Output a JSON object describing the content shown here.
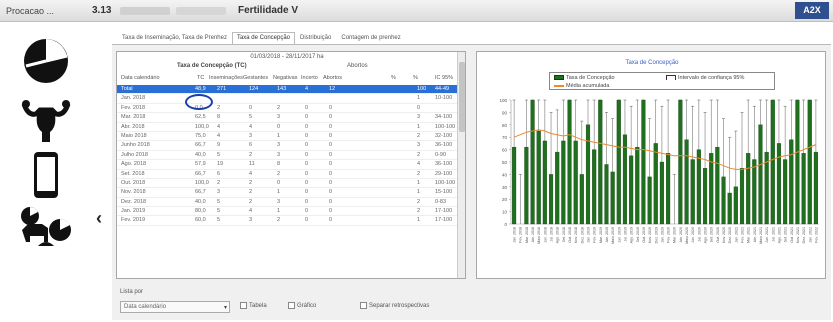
{
  "window": {
    "app_label": "Procacao ...",
    "version": "3.13",
    "title": "Fertilidade V",
    "corner_label": "A2X"
  },
  "left_icons": [
    "pie-chart-icon",
    "uterus-icon",
    "smartphone-icon",
    "cattle-group-icon"
  ],
  "tabs": [
    {
      "label": "Taxa de Inseminação, Taxa de Prenhez",
      "active": false
    },
    {
      "label": "Taxa de Concepção",
      "active": true
    },
    {
      "label": "Distribuição",
      "active": false
    },
    {
      "label": "Contagem de prenhez",
      "active": false
    }
  ],
  "table": {
    "period": "01/03/2018 - 28/11/2017 ha",
    "subtitle": "Taxa de Concepção (TC)",
    "subtitle_right": "Abortos",
    "columns": [
      "Data calendário",
      "TC",
      "Inseminações",
      "Gestantes",
      "Negativas",
      "Incerto",
      "Abortos",
      "%",
      "%",
      "IC 95%"
    ],
    "rows": [
      {
        "date": "Total",
        "tc": "48,9",
        "ins": "271",
        "ges": "124",
        "neg": "143",
        "inc": "4",
        "abo": "12",
        "p1": "",
        "p2": "100",
        "ic": "44-49"
      },
      {
        "date": "Jan. 2018",
        "tc": "",
        "ins": "",
        "ges": "",
        "neg": "",
        "inc": "",
        "abo": "",
        "p1": "",
        "p2": "1",
        "ic": "10-100"
      },
      {
        "date": "Fev. 2018",
        "tc": "0,0",
        "ins": "2",
        "ges": "0",
        "neg": "2",
        "inc": "0",
        "abo": "0",
        "p1": "",
        "p2": "0",
        "ic": ""
      },
      {
        "date": "Mar. 2018",
        "tc": "62,5",
        "ins": "8",
        "ges": "5",
        "neg": "3",
        "inc": "0",
        "abo": "0",
        "p1": "",
        "p2": "3",
        "ic": "34-100"
      },
      {
        "date": "Abr. 2018",
        "tc": "100,0",
        "ins": "4",
        "ges": "4",
        "neg": "0",
        "inc": "0",
        "abo": "0",
        "p1": "",
        "p2": "1",
        "ic": "100-100"
      },
      {
        "date": "Maio 2018",
        "tc": "75,0",
        "ins": "4",
        "ges": "3",
        "neg": "1",
        "inc": "0",
        "abo": "0",
        "p1": "",
        "p2": "2",
        "ic": "32-100"
      },
      {
        "date": "Junho 2018",
        "tc": "66,7",
        "ins": "9",
        "ges": "6",
        "neg": "3",
        "inc": "0",
        "abo": "0",
        "p1": "",
        "p2": "3",
        "ic": "36-100"
      },
      {
        "date": "Julho 2018",
        "tc": "40,0",
        "ins": "5",
        "ges": "2",
        "neg": "3",
        "inc": "0",
        "abo": "0",
        "p1": "",
        "p2": "2",
        "ic": "0-90"
      },
      {
        "date": "Ago. 2018",
        "tc": "57,9",
        "ins": "19",
        "ges": "11",
        "neg": "8",
        "inc": "0",
        "abo": "0",
        "p1": "",
        "p2": "4",
        "ic": "36-100"
      },
      {
        "date": "Set. 2018",
        "tc": "66,7",
        "ins": "6",
        "ges": "4",
        "neg": "2",
        "inc": "0",
        "abo": "0",
        "p1": "",
        "p2": "2",
        "ic": "29-100"
      },
      {
        "date": "Out. 2018",
        "tc": "100,0",
        "ins": "2",
        "ges": "2",
        "neg": "0",
        "inc": "0",
        "abo": "0",
        "p1": "",
        "p2": "1",
        "ic": "100-100"
      },
      {
        "date": "Nov. 2018",
        "tc": "66,7",
        "ins": "3",
        "ges": "2",
        "neg": "1",
        "inc": "0",
        "abo": "0",
        "p1": "",
        "p2": "1",
        "ic": "15-100"
      },
      {
        "date": "Dez. 2018",
        "tc": "40,0",
        "ins": "5",
        "ges": "2",
        "neg": "3",
        "inc": "0",
        "abo": "0",
        "p1": "",
        "p2": "2",
        "ic": "0-83"
      },
      {
        "date": "Jan. 2019",
        "tc": "80,0",
        "ins": "5",
        "ges": "4",
        "neg": "1",
        "inc": "0",
        "abo": "0",
        "p1": "",
        "p2": "2",
        "ic": "17-100"
      },
      {
        "date": "Fev. 2019",
        "tc": "60,0",
        "ins": "5",
        "ges": "3",
        "neg": "2",
        "inc": "0",
        "abo": "0",
        "p1": "",
        "p2": "1",
        "ic": "17-100"
      }
    ]
  },
  "bottom": {
    "list_label": "Lista por",
    "select_value": "Data calendário",
    "checkboxes": [
      "Tabela",
      "Gráfico",
      "Separar retrospectivas"
    ]
  },
  "chart": {
    "title": "Taxa de Concepção",
    "legend": [
      "Taxa de Concepção",
      "Intervalo de confiança 95%",
      "Média acumulada"
    ],
    "colors": {
      "bar": "#1f6f1f",
      "bar_dark": "#0e3f0e",
      "line": "#e88a2e",
      "error": "#333333"
    }
  },
  "chart_data": {
    "type": "bar",
    "title": "Taxa de Concepção",
    "ylim": [
      0,
      100
    ],
    "yticks": [
      0,
      10,
      20,
      30,
      40,
      50,
      60,
      70,
      80,
      90,
      100
    ],
    "categories": [
      "Jan. 2018",
      "Fev. 2018",
      "Mar. 2018",
      "Abr. 2018",
      "Maio 2018",
      "Jun. 2018",
      "Jul. 2018",
      "Ago. 2018",
      "Set. 2018",
      "Out. 2018",
      "Nov. 2018",
      "Dez. 2018",
      "Jan. 2019",
      "Fev. 2019",
      "Mar. 2019",
      "Abr. 2019",
      "Maio 2019",
      "Jun. 2019",
      "Jul. 2019",
      "Ago. 2019",
      "Set. 2019",
      "Out. 2019",
      "Nov. 2019",
      "Dez. 2019",
      "Jan. 2020",
      "Fev. 2020",
      "Mar. 2020",
      "Abr. 2020",
      "Maio 2020",
      "Jun. 2020",
      "Jul. 2020",
      "Ago. 2020",
      "Set. 2020",
      "Out. 2020",
      "Nov. 2020",
      "Dez. 2020",
      "Jan. 2021",
      "Fev. 2021",
      "Mar. 2021",
      "Abr. 2021",
      "Maio 2021",
      "Jun. 2021",
      "Jul. 2021",
      "Ago. 2021",
      "Set. 2021",
      "Out. 2021",
      "Nov. 2021",
      "Dez. 2021",
      "Jan. 2022",
      "Fev. 2022"
    ],
    "series": [
      {
        "name": "Taxa de Concepção",
        "values": [
          62,
          0,
          62,
          100,
          75,
          67,
          40,
          58,
          67,
          100,
          67,
          40,
          80,
          60,
          100,
          48,
          42,
          100,
          72,
          55,
          62,
          100,
          38,
          65,
          50,
          57,
          0,
          100,
          68,
          52,
          60,
          45,
          57,
          62,
          38,
          25,
          30,
          45,
          57,
          52,
          80,
          58,
          100,
          65,
          52,
          68,
          100,
          57,
          100,
          58
        ]
      },
      {
        "name": "Média acumulada",
        "values": [
          70,
          72,
          74,
          75,
          76,
          75,
          73,
          72,
          71,
          72,
          70,
          68,
          67,
          66,
          65,
          64,
          63,
          62,
          62,
          61,
          60,
          60,
          59,
          58,
          57,
          56,
          55,
          55,
          55,
          54,
          53,
          52,
          50,
          49,
          47,
          45,
          44,
          44,
          45,
          46,
          48,
          50,
          52,
          54,
          55,
          56,
          58,
          60,
          62,
          64
        ]
      }
    ],
    "error_high": [
      100,
      40,
      100,
      100,
      100,
      100,
      90,
      92,
      100,
      100,
      100,
      83,
      100,
      100,
      100,
      90,
      85,
      100,
      100,
      95,
      100,
      100,
      85,
      100,
      95,
      100,
      40,
      100,
      100,
      95,
      100,
      90,
      100,
      100,
      85,
      70,
      75,
      90,
      100,
      95,
      100,
      100,
      100,
      100,
      95,
      100,
      100,
      100,
      100,
      100
    ]
  }
}
